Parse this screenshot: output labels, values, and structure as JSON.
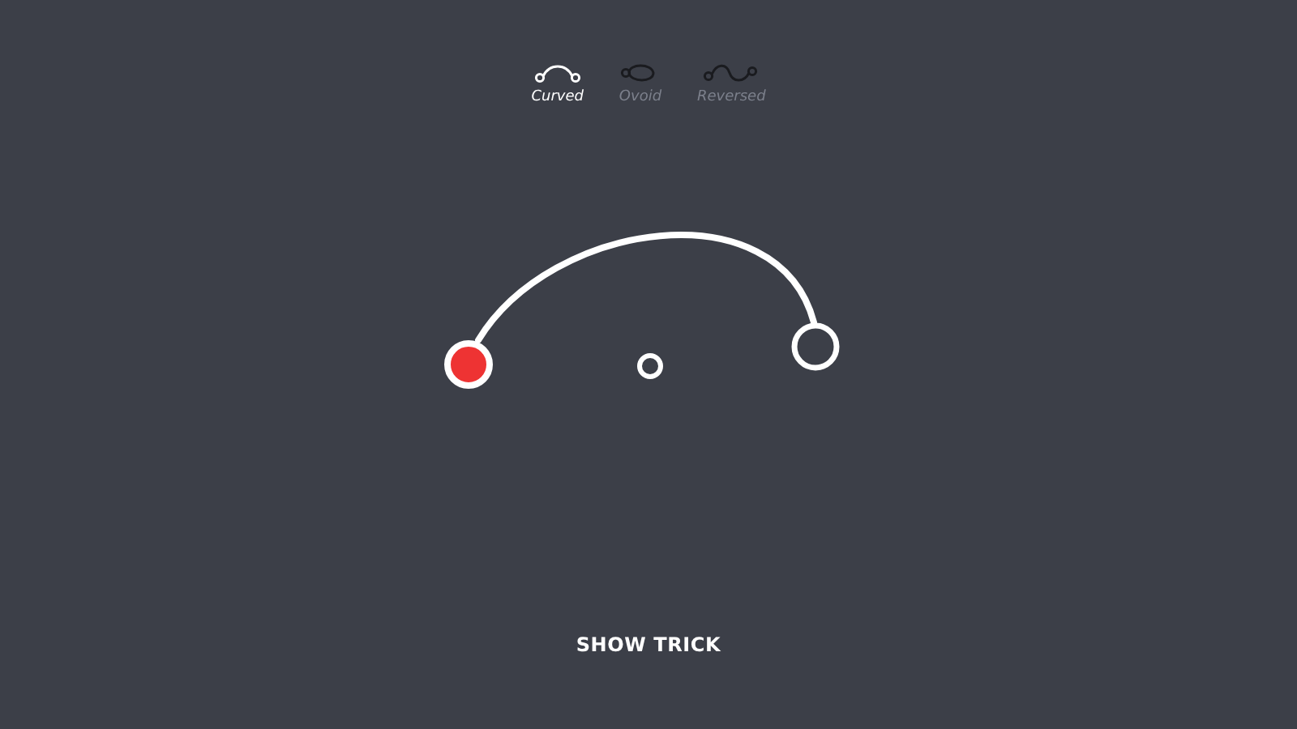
{
  "tabs": [
    {
      "label": "Curved",
      "kind": "arc",
      "selected": true
    },
    {
      "label": "Ovoid",
      "kind": "blob",
      "selected": false
    },
    {
      "label": "Reversed",
      "kind": "wave",
      "selected": false
    }
  ],
  "button": "SHOW TRICK"
}
